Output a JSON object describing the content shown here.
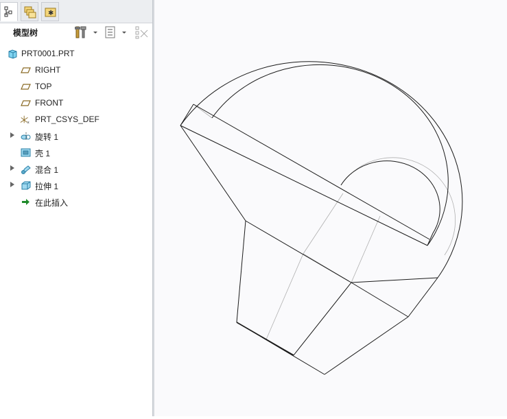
{
  "panel": {
    "title": "模型树",
    "tabs": [
      {
        "name": "model-tree-tab",
        "icon": "tree-icon"
      },
      {
        "name": "folder-browser-tab",
        "icon": "folders-icon"
      },
      {
        "name": "favorites-tab",
        "icon": "favorites-icon"
      }
    ]
  },
  "tree": {
    "items": [
      {
        "label": "PRT0001.PRT",
        "icon": "part-icon",
        "expandable": false
      },
      {
        "label": "RIGHT",
        "icon": "datum-plane-icon",
        "expandable": false
      },
      {
        "label": "TOP",
        "icon": "datum-plane-icon",
        "expandable": false
      },
      {
        "label": "FRONT",
        "icon": "datum-plane-icon",
        "expandable": false
      },
      {
        "label": "PRT_CSYS_DEF",
        "icon": "csys-icon",
        "expandable": false
      },
      {
        "label": "旋转 1",
        "icon": "revolve-icon",
        "expandable": true
      },
      {
        "label": "壳 1",
        "icon": "shell-icon",
        "expandable": false
      },
      {
        "label": "混合 1",
        "icon": "blend-icon",
        "expandable": true
      },
      {
        "label": "拉伸 1",
        "icon": "extrude-icon",
        "expandable": true
      },
      {
        "label": "在此插入",
        "icon": "insert-here-arrow-icon",
        "expandable": false
      }
    ]
  },
  "colors": {
    "model_edge": "#1a1a1a",
    "hidden_edge": "#b0b0b0",
    "insert_arrow": "#1f8a2a"
  }
}
